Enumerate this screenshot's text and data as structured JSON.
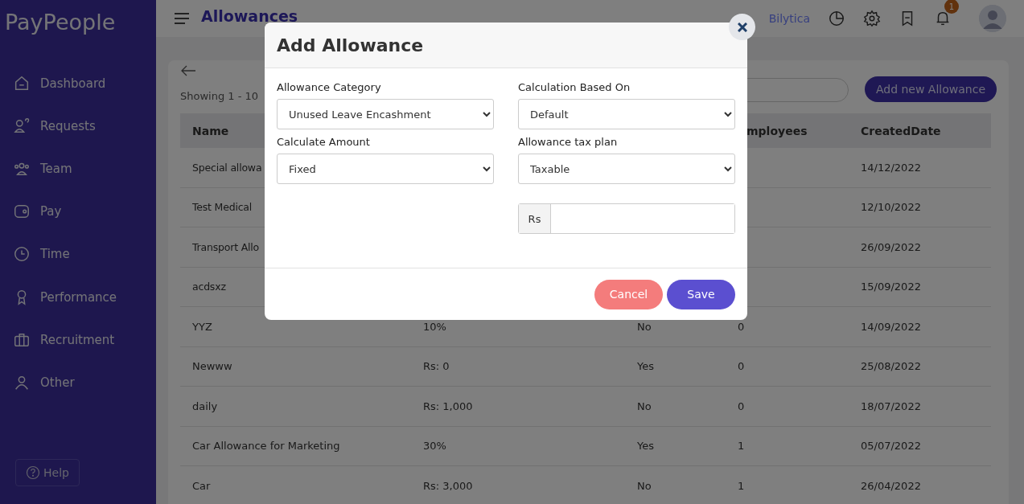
{
  "sidebar": {
    "logo": "PayPeople",
    "items": [
      {
        "label": "Dashboard"
      },
      {
        "label": "Requests"
      },
      {
        "label": "Team"
      },
      {
        "label": "Pay"
      },
      {
        "label": "Time"
      },
      {
        "label": "Performance"
      },
      {
        "label": "Recruitment"
      },
      {
        "label": "Other"
      }
    ],
    "help": "Help"
  },
  "header": {
    "title": "Allowances",
    "company": "Bilytica",
    "notifications": "1"
  },
  "content": {
    "showing": "Showing 1 - 10",
    "add_button": "Add new Allowance",
    "table": {
      "columns": [
        "Name",
        null,
        null,
        "mployees",
        "CreatedDate"
      ],
      "rows": [
        [
          "Special allowa",
          null,
          null,
          null,
          "14/12/2022"
        ],
        [
          "Test Medical",
          null,
          null,
          null,
          "12/10/2022"
        ],
        [
          "Transport Allo",
          null,
          null,
          null,
          "26/09/2022"
        ],
        [
          "acdsxz",
          null,
          null,
          null,
          "15/09/2022"
        ],
        [
          "YYZ",
          "10%",
          "No",
          "0",
          "14/09/2022"
        ],
        [
          "Newww",
          "Rs: 0",
          "Yes",
          "0",
          "25/08/2022"
        ],
        [
          "daily",
          "Rs: 1,000",
          "No",
          "0",
          "18/07/2022"
        ],
        [
          "Car Allowance for Marketing",
          "30%",
          "Yes",
          "1",
          "05/07/2022"
        ],
        [
          "Car",
          "Rs: 3,000",
          "No",
          "1",
          "26/04/2022"
        ]
      ]
    }
  },
  "modal": {
    "title": "Add Allowance",
    "fields": [
      {
        "kind": "select",
        "label": "Allowance Category",
        "value": "Unused Leave Encashment"
      },
      {
        "kind": "select",
        "label": "Calculation Based On",
        "value": "Default"
      },
      {
        "kind": "select",
        "label": "Calculate Amount",
        "value": "Fixed"
      },
      {
        "kind": "select",
        "label": "Allowance tax plan",
        "value": "Taxable"
      },
      {
        "kind": "spacer"
      },
      {
        "kind": "amount",
        "prefix": "Rs"
      }
    ],
    "buttons": [
      {
        "label": "Cancel",
        "kind": "cancel"
      },
      {
        "label": "Save",
        "kind": "primary"
      }
    ]
  }
}
